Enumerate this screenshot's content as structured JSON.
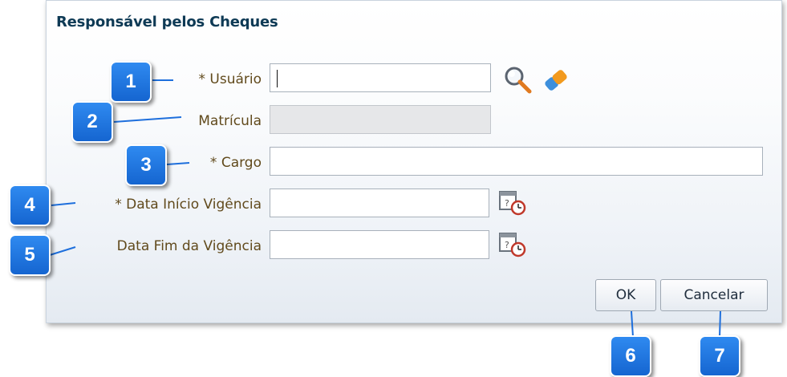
{
  "dialog": {
    "title": "Responsável pelos Cheques"
  },
  "fields": [
    {
      "label": "* Usuário",
      "value": ""
    },
    {
      "label": "Matrícula",
      "value": ""
    },
    {
      "label": "* Cargo",
      "value": ""
    },
    {
      "label": "* Data Início Vigência",
      "value": ""
    },
    {
      "label": "Data Fim da Vigência",
      "value": ""
    }
  ],
  "icons": {
    "search": "search-icon",
    "clear": "eraser-icon",
    "date": "calendar-clock-icon"
  },
  "buttons": {
    "ok": "OK",
    "cancel": "Cancelar"
  },
  "callouts": [
    "1",
    "2",
    "3",
    "4",
    "5",
    "6",
    "7"
  ],
  "colors": {
    "title": "#0e3a55",
    "label": "#614a1c",
    "callout": "#1e6fdc"
  }
}
